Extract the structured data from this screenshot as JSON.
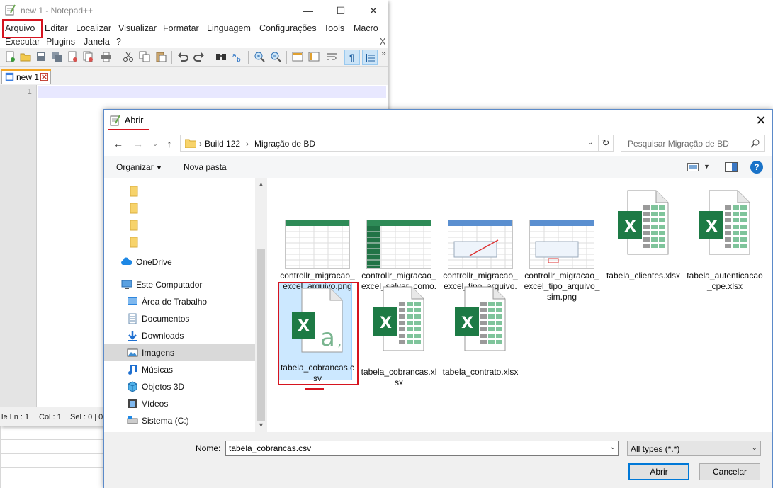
{
  "notepad": {
    "title": "new 1 - Notepad++",
    "menu": [
      "Arquivo",
      "Editar",
      "Localizar",
      "Visualizar",
      "Formatar",
      "Linguagem",
      "Configurações",
      "Tools",
      "Macro",
      "Executar",
      "Plugins",
      "Janela",
      "?"
    ],
    "menu_close": "X",
    "toolbar_more": "»",
    "tab_label": "new 1",
    "line_number": "1",
    "status": {
      "ln": "le Ln : 1",
      "col": "Col : 1",
      "sel": "Sel : 0 | 0"
    }
  },
  "dialog": {
    "title": "Abrir",
    "breadcrumb": [
      "Build 122",
      "Migração de BD"
    ],
    "search_placeholder": "Pesquisar Migração de BD",
    "organize_label": "Organizar",
    "new_folder_label": "Nova pasta",
    "nav_items": [
      {
        "label": "",
        "icon": "folder-icon"
      },
      {
        "label": "",
        "icon": "folder-icon"
      },
      {
        "label": "",
        "icon": "folder-icon"
      },
      {
        "label": "",
        "icon": "folder-icon"
      },
      {
        "label": "OneDrive",
        "icon": "cloud-icon"
      },
      {
        "label": "Este Computador",
        "icon": "computer-icon"
      },
      {
        "label": "Área de Trabalho",
        "icon": "desktop-icon"
      },
      {
        "label": "Documentos",
        "icon": "documents-icon"
      },
      {
        "label": "Downloads",
        "icon": "download-icon"
      },
      {
        "label": "Imagens",
        "icon": "images-icon"
      },
      {
        "label": "Músicas",
        "icon": "music-icon"
      },
      {
        "label": "Objetos 3D",
        "icon": "cube-icon"
      },
      {
        "label": "Vídeos",
        "icon": "video-icon"
      },
      {
        "label": "Sistema (C:)",
        "icon": "drive-icon"
      }
    ],
    "files": [
      {
        "name": "controllr_migracao_excel_arquivo.png",
        "type": "png"
      },
      {
        "name": "controllr_migracao_excel_salvar_como.png",
        "type": "png"
      },
      {
        "name": "controllr_migracao_excel_tipo_arquivo.png",
        "type": "png"
      },
      {
        "name": "controllr_migracao_excel_tipo_arquivo_sim.png",
        "type": "png"
      },
      {
        "name": "tabela_clientes.xlsx",
        "type": "xlsx"
      },
      {
        "name": "tabela_autenticacao_cpe.xlsx",
        "type": "xlsx"
      },
      {
        "name": "tabela_cobrancas.csv",
        "type": "csv",
        "selected": true
      },
      {
        "name": "tabela_cobrancas.xlsx",
        "type": "xlsx"
      },
      {
        "name": "tabela_contrato.xlsx",
        "type": "xlsx"
      }
    ],
    "file_name_label": "Nome:",
    "file_name_value": "tabela_cobrancas.csv",
    "file_type_value": "All types (*.*)",
    "open_label": "Abrir",
    "cancel_label": "Cancelar",
    "accent_color": "#d6141f",
    "excel_green": "#1d7a45"
  }
}
